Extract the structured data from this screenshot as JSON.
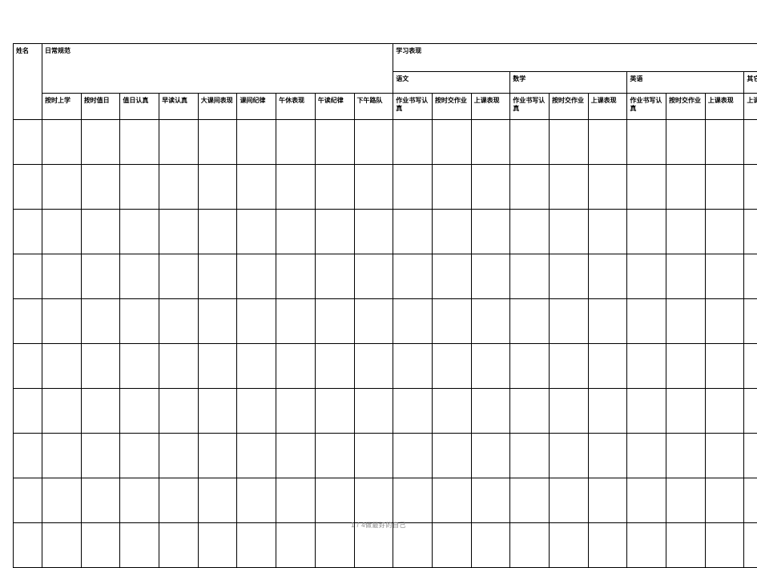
{
  "header": {
    "name_col": "姓名",
    "daily_section": "日常规范",
    "study_section": "学习表现",
    "subjects": {
      "chinese": "语文",
      "math": "数学",
      "english": "英语",
      "other": "其它科目"
    },
    "daily_cols": [
      "按时上学",
      "按时值日",
      "值日认真",
      "早读认真",
      "大课间表现",
      "课间纪律",
      "午休表现",
      "午读纪律",
      "下午路队"
    ],
    "subject_cols": [
      "作业书写认真",
      "按时交作业",
      "上课表现"
    ],
    "other_col": "上课情况"
  },
  "body_rows": 10,
  "footer": "1 / 4做最好的自己"
}
